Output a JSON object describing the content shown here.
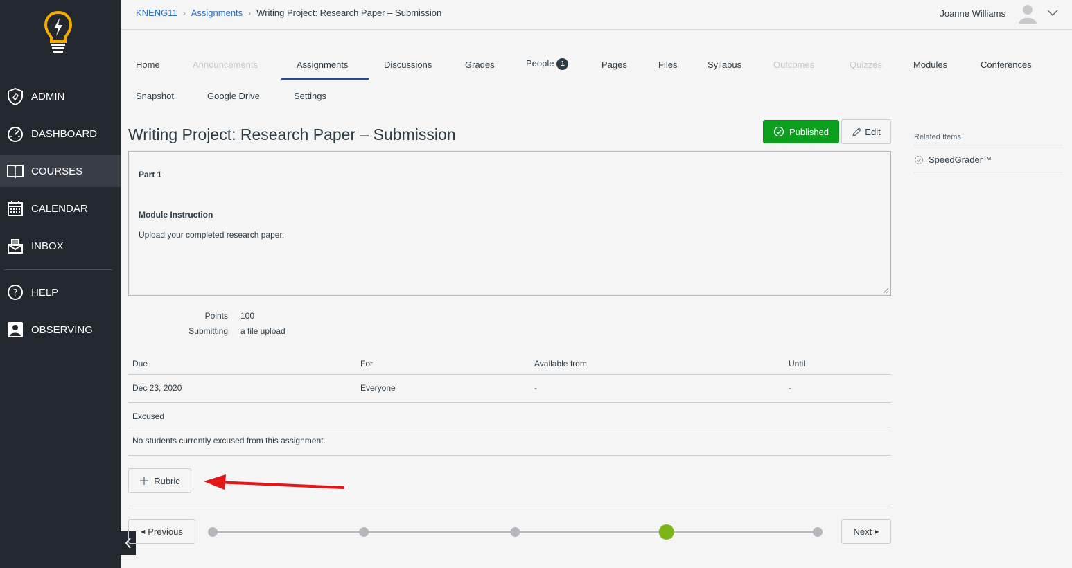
{
  "sidebar": {
    "items": [
      {
        "label": "ADMIN",
        "icon": "shield-icon"
      },
      {
        "label": "DASHBOARD",
        "icon": "dashboard-icon"
      },
      {
        "label": "COURSES",
        "icon": "book-icon",
        "active": true
      },
      {
        "label": "CALENDAR",
        "icon": "calendar-icon"
      },
      {
        "label": "INBOX",
        "icon": "inbox-icon"
      },
      {
        "label": "HELP",
        "icon": "help-icon"
      },
      {
        "label": "OBSERVING",
        "icon": "observer-icon"
      }
    ],
    "logo_icon": "lightbulb-logo-icon"
  },
  "breadcrumb": {
    "course": "KNENG11",
    "section": "Assignments",
    "current": "Writing Project: Research Paper – Submission"
  },
  "user": {
    "name": "Joanne Williams"
  },
  "course_nav": {
    "tabs": [
      {
        "label": "Home"
      },
      {
        "label": "Announcements",
        "disabled": true
      },
      {
        "label": "Assignments",
        "active": true
      },
      {
        "label": "Discussions"
      },
      {
        "label": "Grades"
      },
      {
        "label": "People",
        "badge": "1"
      },
      {
        "label": "Pages"
      },
      {
        "label": "Files"
      },
      {
        "label": "Syllabus"
      },
      {
        "label": "Outcomes",
        "disabled": true
      },
      {
        "label": "Quizzes",
        "disabled": true
      },
      {
        "label": "Modules"
      },
      {
        "label": "Conferences"
      },
      {
        "label": "Snapshot"
      },
      {
        "label": "Google Drive"
      },
      {
        "label": "Settings"
      }
    ]
  },
  "assignment": {
    "title": "Writing Project: Research Paper – Submission",
    "published_label": "Published",
    "edit_label": "Edit",
    "description": {
      "part": "Part 1",
      "heading": "Module Instruction",
      "text": "Upload your completed research paper."
    },
    "points_label": "Points",
    "points_value": "100",
    "submitting_label": "Submitting",
    "submitting_value": "a file upload"
  },
  "dates_table": {
    "headers": [
      "Due",
      "For",
      "Available from",
      "Until"
    ],
    "row": [
      "Dec 23, 2020",
      "Everyone",
      "-",
      "-"
    ]
  },
  "excused": {
    "heading": "Excused",
    "text": "No students currently excused from this assignment."
  },
  "rubric": {
    "label": "Rubric"
  },
  "footer_nav": {
    "previous_label": "Previous",
    "next_label": "Next",
    "current_step": 4,
    "total_steps": 5
  },
  "related": {
    "title": "Related Items",
    "items": [
      {
        "label": "SpeedGrader™"
      }
    ]
  },
  "colors": {
    "sidebar_bg": "#23272e",
    "published_green": "#0b9f1d",
    "link_blue": "#2b6ec8",
    "progress_active": "#7cb518",
    "arrow_red": "#e3161a"
  }
}
